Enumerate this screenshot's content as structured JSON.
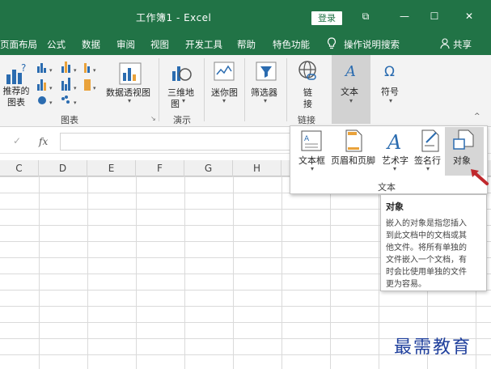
{
  "window": {
    "title": "工作簿1 - Excel",
    "login_label": "登录",
    "controls": [
      "⧉",
      "—",
      "☐",
      "✕"
    ]
  },
  "tabs": [
    "页面布局",
    "公式",
    "数据",
    "审阅",
    "视图",
    "开发工具",
    "帮助",
    "特色功能"
  ],
  "search_label": "操作说明搜索",
  "share_label": "共享",
  "ribbon": {
    "recommended_chart": "推荐的\n图表",
    "pivot_chart": "数据透视图",
    "map_3d_line1": "三维地",
    "map_3d_line2": "图",
    "sparkline": "迷你图",
    "filter": "筛选器",
    "link_line1": "链",
    "link_line2": "接",
    "text": "文本",
    "symbol": "符号",
    "groups": {
      "charts": "图表",
      "tours": "演示",
      "links": "链接"
    }
  },
  "formula_bar": {
    "fx": "fx",
    "check": "✓"
  },
  "columns": [
    "C",
    "D",
    "E",
    "F",
    "G",
    "H"
  ],
  "text_panel": {
    "items": [
      "文本框",
      "页眉和页脚",
      "艺术字",
      "签名行",
      "对象"
    ],
    "group_label": "文本"
  },
  "tooltip": {
    "title": "对象",
    "lines": [
      "嵌入的对象是指您插入",
      "到此文档中的文档或其",
      "他文件。将所有单独的",
      "文件嵌入一个文档，有",
      "时会比使用单独的文件",
      "更为容易。"
    ]
  },
  "watermark": "最需教育",
  "colors": {
    "accent": "#217346",
    "arrow": "#c0282c",
    "watermark": "#1f3f9c"
  }
}
